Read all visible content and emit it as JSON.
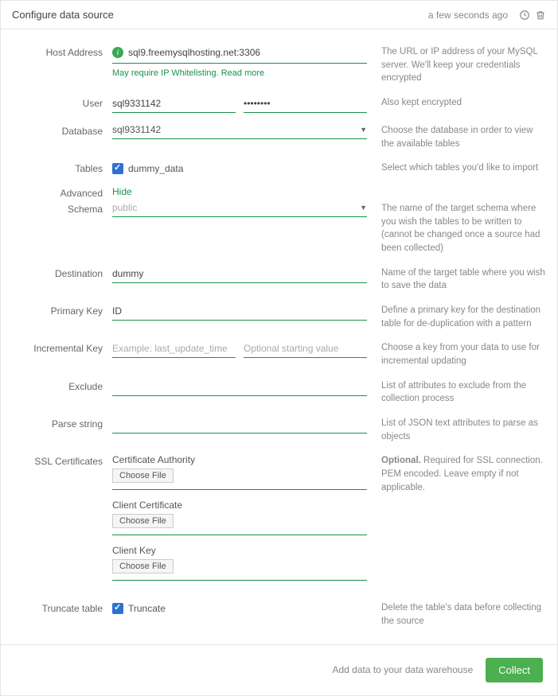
{
  "header": {
    "title": "Configure data source",
    "time": "a few seconds ago"
  },
  "labels": {
    "host": "Host Address",
    "user": "User",
    "database": "Database",
    "tables": "Tables",
    "advanced": "Advanced",
    "schema": "Schema",
    "destination": "Destination",
    "primaryKey": "Primary Key",
    "incrementalKey": "Incremental Key",
    "exclude": "Exclude",
    "parseString": "Parse string",
    "sslCert": "SSL Certificates",
    "truncate": "Truncate table"
  },
  "values": {
    "host": "sql9.freemysqlhosting.net:3306",
    "user": "sql9331142",
    "password": "••••••••",
    "database": "sql9331142",
    "table": "dummy_data",
    "hide": "Hide",
    "schema": "public",
    "destination": "dummy",
    "primaryKey": "ID",
    "truncateLabel": "Truncate"
  },
  "placeholders": {
    "incrementalKey": "Example: last_update_time",
    "incrementalStart": "Optional starting value"
  },
  "whitelist": "May require IP Whitelisting. Read more",
  "ssl": {
    "ca": "Certificate Authority",
    "clientCert": "Client Certificate",
    "clientKey": "Client Key",
    "choose": "Choose File"
  },
  "help": {
    "host": "The URL or IP address of your MySQL server. We'll keep your credentials encrypted",
    "user": "Also kept encrypted",
    "database": "Choose the database in order to view the available tables",
    "tables": "Select which tables you'd like to import",
    "schema": "The name of the target schema where you wish the tables to be written to (cannot be changed once a source had been collected)",
    "destination": "Name of the target table where you wish to save the data",
    "primaryKey": "Define a primary key for the destination table for de-duplication with a pattern",
    "incrementalKey": "Choose a key from your data to use for incremental updating",
    "exclude": "List of attributes to exclude from the collection process",
    "parseString": "List of JSON text attributes to parse as objects",
    "sslBold": "Optional.",
    "ssl": " Required for SSL connection. PEM encoded. Leave empty if not applicable.",
    "truncate": "Delete the table's data before collecting the source"
  },
  "footer": {
    "text": "Add data to your data warehouse",
    "collect": "Collect"
  }
}
